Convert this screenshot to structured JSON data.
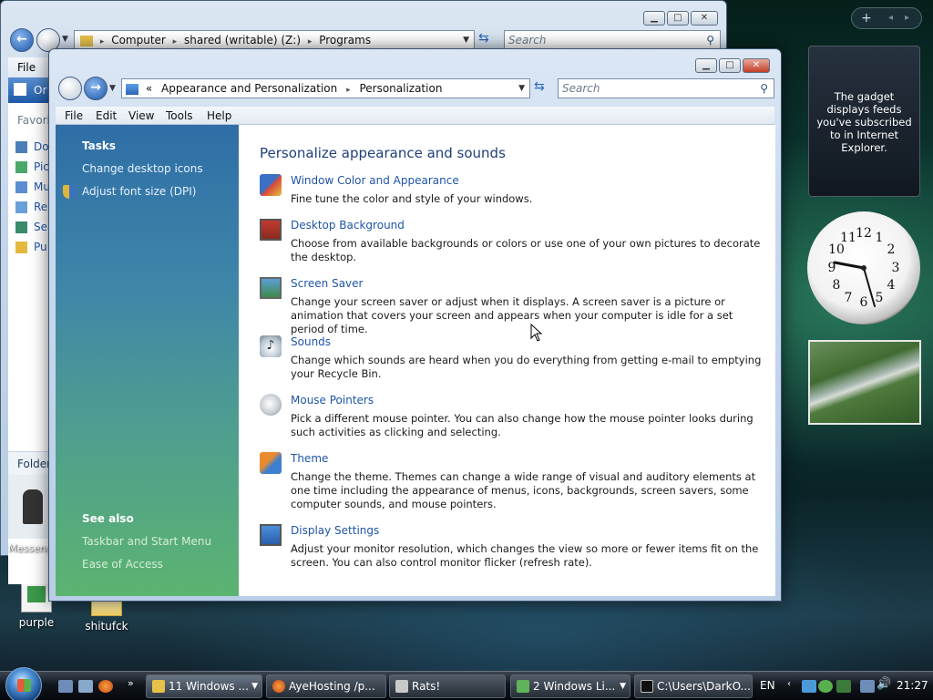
{
  "back_window": {
    "breadcrumb": [
      "Computer",
      "shared (writable) (Z:)",
      "Programs"
    ],
    "search_placeholder": "Search",
    "menu_file": "File",
    "organize_label": "Or",
    "favorites_label": "Favorit",
    "favorites_items": [
      "Do",
      "Pic",
      "Mu",
      "Re",
      "Sea",
      "Pu"
    ],
    "folders_label": "Folder",
    "messenger_label": "Messeng"
  },
  "front_window": {
    "breadcrumb_prefix": "«",
    "breadcrumb": [
      "Appearance and Personalization",
      "Personalization"
    ],
    "search_placeholder": "Search",
    "menu": [
      "File",
      "Edit",
      "View",
      "Tools",
      "Help"
    ],
    "tasks_heading": "Tasks",
    "tasks": [
      "Change desktop icons",
      "Adjust font size (DPI)"
    ],
    "see_also_heading": "See also",
    "see_also": [
      "Taskbar and Start Menu",
      "Ease of Access"
    ],
    "heading": "Personalize appearance and sounds",
    "items": [
      {
        "title": "Window Color and Appearance",
        "desc": "Fine tune the color and style of your windows."
      },
      {
        "title": "Desktop Background",
        "desc": "Choose from available backgrounds or colors or use one of your own pictures to decorate the desktop."
      },
      {
        "title": "Screen Saver",
        "desc": "Change your screen saver or adjust when it displays. A screen saver is a picture or animation that covers your screen and appears when your computer is idle for a set period of time."
      },
      {
        "title": "Sounds",
        "desc": "Change which sounds are heard when you do everything from getting e-mail to emptying your Recycle Bin."
      },
      {
        "title": "Mouse Pointers",
        "desc": "Pick a different mouse pointer. You can also change how the mouse pointer looks during such activities as clicking and selecting."
      },
      {
        "title": "Theme",
        "desc": "Change the theme. Themes can change a wide range of visual and auditory elements at one time including the appearance of menus, icons, backgrounds, screen savers, some computer sounds, and mouse pointers."
      },
      {
        "title": "Display Settings",
        "desc": "Adjust your monitor resolution, which changes the view so more or fewer items fit on the screen. You can also control monitor flicker (refresh rate)."
      }
    ]
  },
  "sidebar": {
    "add_symbol": "+",
    "feed_text": "The gadget displays feeds you've subscribed to in Internet Explorer.",
    "clock_numbers": [
      "12",
      "1",
      "2",
      "3",
      "4",
      "5",
      "6",
      "7",
      "8",
      "9",
      "10",
      "11"
    ],
    "clock_time": "21:27"
  },
  "desktop_icons": [
    "purple",
    "shitufck"
  ],
  "taskbar": {
    "items": [
      "11 Windows ...",
      "AyeHosting /p...",
      "Rats!",
      "2 Windows Li...",
      "C:\\Users\\DarkO..."
    ],
    "language": "EN",
    "time": "21:27"
  },
  "colors": {
    "link": "#1f55a8",
    "heading": "#1e3f7a",
    "task_pane_top": "#2f6ea6",
    "task_pane_bottom": "#5bb470"
  }
}
